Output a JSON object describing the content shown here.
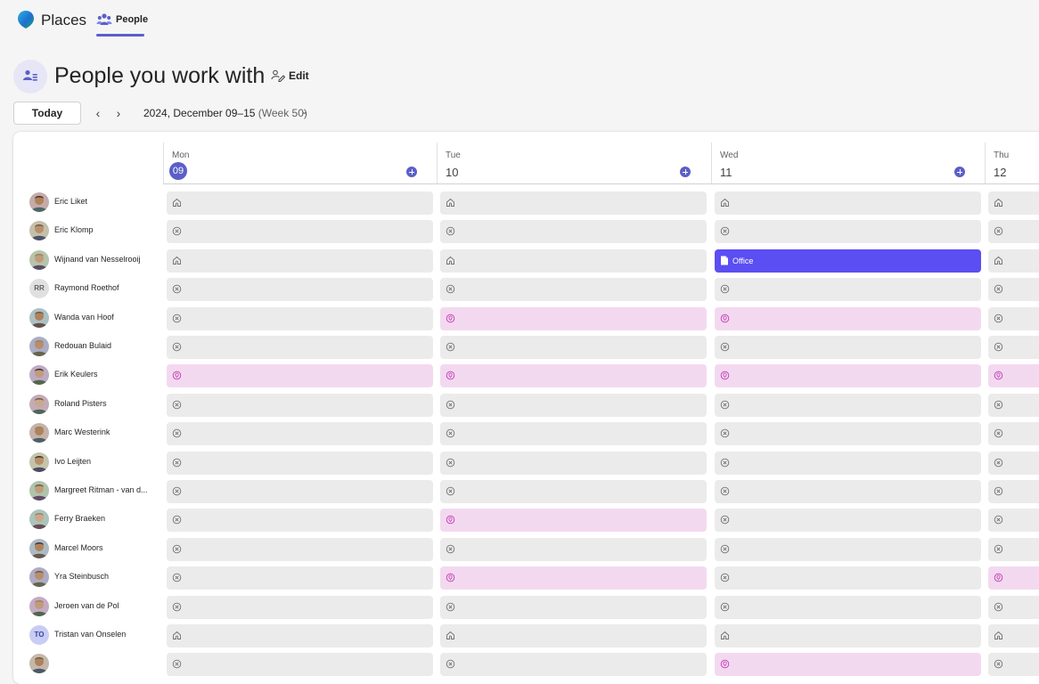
{
  "app": {
    "title": "Places"
  },
  "nav": {
    "active_tab": "People"
  },
  "page": {
    "title": "People you work with",
    "edit_label": "Edit"
  },
  "toolbar": {
    "today_label": "Today",
    "prev": "‹",
    "next": "›",
    "range_label": "2024, December 09–15",
    "week_label": "(Week 50)",
    "chevron": "⌄"
  },
  "colors": {
    "accent": "#5b5fc7",
    "office": "#5b4ef2",
    "remote": "#f3d9f0",
    "none": "#ebebeb"
  },
  "days": [
    {
      "name": "Mon",
      "num": "09",
      "active": true
    },
    {
      "name": "Tue",
      "num": "10",
      "active": false
    },
    {
      "name": "Wed",
      "num": "11",
      "active": false
    },
    {
      "name": "Thu",
      "num": "12",
      "active": false
    }
  ],
  "status_legend": {
    "home": "home-icon",
    "none": "no-plan-icon",
    "remote": "location-icon",
    "office": "office-icon"
  },
  "office_label": "Office",
  "people": [
    {
      "name": "Eric Liket",
      "avatar": "photo",
      "status": [
        "home",
        "home",
        "home",
        "home"
      ]
    },
    {
      "name": "Eric Klomp",
      "avatar": "photo",
      "status": [
        "none",
        "none",
        "none",
        "none"
      ]
    },
    {
      "name": "Wijnand van Nesselrooij",
      "avatar": "photo",
      "status": [
        "home",
        "home",
        "office",
        "home"
      ]
    },
    {
      "name": "Raymond Roethof",
      "avatar": "RR",
      "status": [
        "none",
        "none",
        "none",
        "none"
      ]
    },
    {
      "name": "Wanda van Hoof",
      "avatar": "photo",
      "status": [
        "none",
        "remote",
        "remote",
        "none"
      ]
    },
    {
      "name": "Redouan Bulaid",
      "avatar": "photo",
      "status": [
        "none",
        "none",
        "none",
        "none"
      ]
    },
    {
      "name": "Erik Keulers",
      "avatar": "photo",
      "status": [
        "remote",
        "remote",
        "remote",
        "remote"
      ]
    },
    {
      "name": "Roland Pisters",
      "avatar": "photo",
      "status": [
        "none",
        "none",
        "none",
        "none"
      ]
    },
    {
      "name": "Marc Westerink",
      "avatar": "photo",
      "status": [
        "none",
        "none",
        "none",
        "none"
      ]
    },
    {
      "name": "Ivo Leijten",
      "avatar": "photo",
      "status": [
        "none",
        "none",
        "none",
        "none"
      ]
    },
    {
      "name": "Margreet Ritman - van d...",
      "avatar": "photo",
      "status": [
        "none",
        "none",
        "none",
        "none"
      ]
    },
    {
      "name": "Ferry Braeken",
      "avatar": "photo",
      "status": [
        "none",
        "remote",
        "none",
        "none"
      ]
    },
    {
      "name": "Marcel Moors",
      "avatar": "photo",
      "status": [
        "none",
        "none",
        "none",
        "none"
      ]
    },
    {
      "name": "Yra Steinbusch",
      "avatar": "photo",
      "status": [
        "none",
        "remote",
        "none",
        "remote"
      ]
    },
    {
      "name": "Jeroen van de Pol",
      "avatar": "photo",
      "status": [
        "none",
        "none",
        "none",
        "none"
      ]
    },
    {
      "name": "Tristan van Onselen",
      "avatar": "TO",
      "status": [
        "home",
        "home",
        "home",
        "home"
      ]
    },
    {
      "name": "",
      "avatar": "photo",
      "status": [
        "none",
        "none",
        "remote",
        "none"
      ]
    }
  ]
}
